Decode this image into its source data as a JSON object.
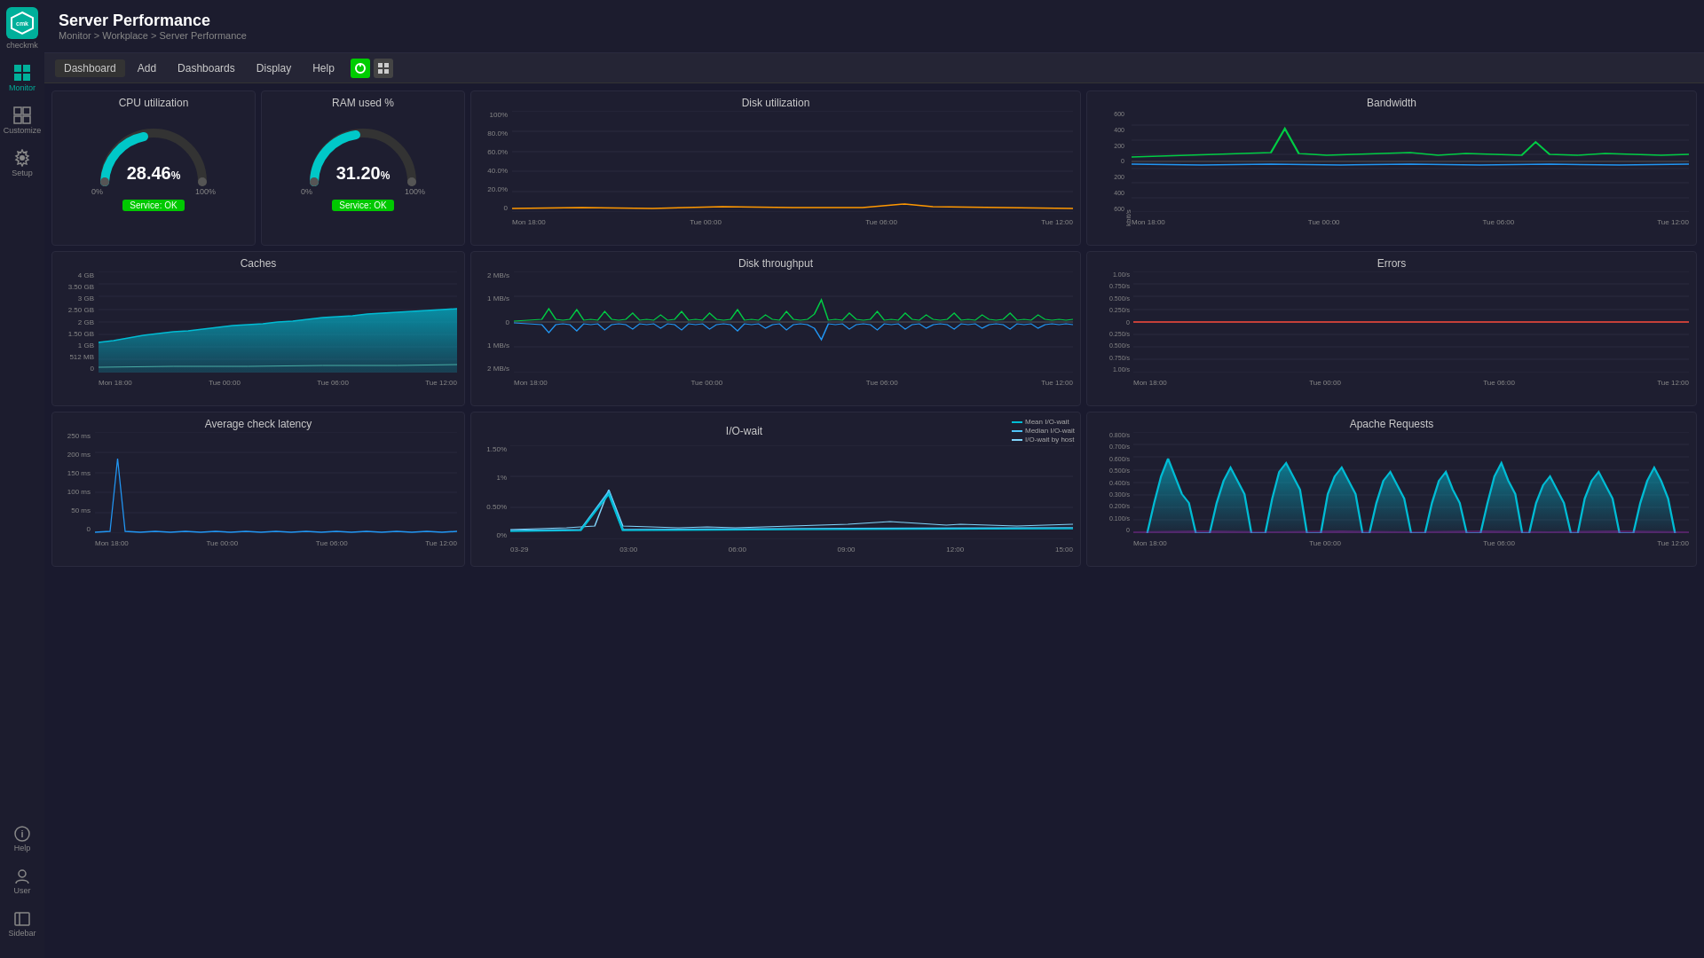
{
  "app": {
    "name": "checkmk",
    "logo_text": "cmk"
  },
  "header": {
    "title": "Server Performance",
    "breadcrumb": "Monitor > Workplace > Server Performance"
  },
  "toolbar": {
    "buttons": [
      "Dashboard",
      "Add",
      "Dashboards",
      "Display",
      "Help"
    ]
  },
  "sidebar": {
    "items": [
      {
        "id": "monitor",
        "label": "Monitor",
        "icon": "▦",
        "active": true
      },
      {
        "id": "customize",
        "label": "Customize",
        "icon": "⊞",
        "active": false
      },
      {
        "id": "setup",
        "label": "Setup",
        "icon": "⚙",
        "active": false
      }
    ],
    "bottom_items": [
      {
        "id": "help",
        "label": "Help",
        "icon": "ℹ"
      },
      {
        "id": "user",
        "label": "User",
        "icon": "👤"
      },
      {
        "id": "sidebar",
        "label": "Sidebar",
        "icon": "◫"
      }
    ]
  },
  "panels": {
    "cpu": {
      "title": "CPU utilization",
      "value": "28.46",
      "unit": "%",
      "min_label": "0%",
      "max_label": "100%",
      "status": "Service: OK",
      "color": "#00c8c8"
    },
    "ram": {
      "title": "RAM used %",
      "value": "31.20",
      "unit": "%",
      "min_label": "0%",
      "max_label": "100%",
      "status": "Service: OK",
      "color": "#00c8c8"
    },
    "disk_util": {
      "title": "Disk utilization",
      "y_labels": [
        "100%",
        "80.0%",
        "60.0%",
        "40.0%",
        "20.0%",
        "0"
      ],
      "x_labels": [
        "Mon 18:00",
        "Tue 00:00",
        "Tue 06:00",
        "Tue 12:00"
      ]
    },
    "bandwidth": {
      "title": "Bandwidth",
      "y_labels": [
        "600",
        "400",
        "200",
        "0",
        "200",
        "400",
        "600"
      ],
      "y_unit": "kbit/s",
      "x_labels": [
        "Mon 18:00",
        "Tue 00:00",
        "Tue 06:00",
        "Tue 12:00"
      ]
    },
    "caches": {
      "title": "Caches",
      "y_labels": [
        "4 GB",
        "3.50 GB",
        "3 GB",
        "2.50 GB",
        "2 GB",
        "1.50 GB",
        "1 GB",
        "512 MB",
        "0"
      ],
      "x_labels": [
        "Mon 18:00",
        "Tue 00:00",
        "Tue 06:00",
        "Tue 12:00"
      ]
    },
    "disk_throughput": {
      "title": "Disk throughput",
      "y_labels": [
        "2 MB/s",
        "1 MB/s",
        "0",
        "1 MB/s",
        "2 MB/s"
      ],
      "x_labels": [
        "Mon 18:00",
        "Tue 00:00",
        "Tue 06:00",
        "Tue 12:00"
      ]
    },
    "errors": {
      "title": "Errors",
      "y_labels": [
        "1.00/s",
        "0.750/s",
        "0.500/s",
        "0.250/s",
        "0",
        "0.250/s",
        "0.500/s",
        "0.750/s",
        "1.00/s"
      ],
      "x_labels": [
        "Mon 18:00",
        "Tue 00:00",
        "Tue 06:00",
        "Tue 12:00"
      ]
    },
    "avg_latency": {
      "title": "Average check latency",
      "y_labels": [
        "250 ms",
        "200 ms",
        "150 ms",
        "100 ms",
        "50 ms",
        "0"
      ],
      "x_labels": [
        "Mon 18:00",
        "Tue 00:00",
        "Tue 06:00",
        "Tue 12:00"
      ]
    },
    "io_wait": {
      "title": "I/O-wait",
      "y_labels": [
        "1.50%",
        "1%",
        "0.50%",
        "0%"
      ],
      "x_labels": [
        "03-29",
        "03:00",
        "06:00",
        "09:00",
        "12:00",
        "15:00"
      ],
      "legend": [
        {
          "label": "Mean I/O-wait",
          "color": "#00bcd4"
        },
        {
          "label": "Median I/O-wait",
          "color": "#4fc3f7"
        },
        {
          "label": "I/O-wait by host",
          "color": "#81d4fa"
        }
      ]
    },
    "apache": {
      "title": "Apache Requests",
      "y_labels": [
        "0.800/s",
        "0.700/s",
        "0.600/s",
        "0.500/s",
        "0.400/s",
        "0.300/s",
        "0.200/s",
        "0.100/s",
        "0"
      ],
      "x_labels": [
        "Mon 18:00",
        "Tue 00:00",
        "Tue 06:00",
        "Tue 12:00"
      ]
    }
  }
}
